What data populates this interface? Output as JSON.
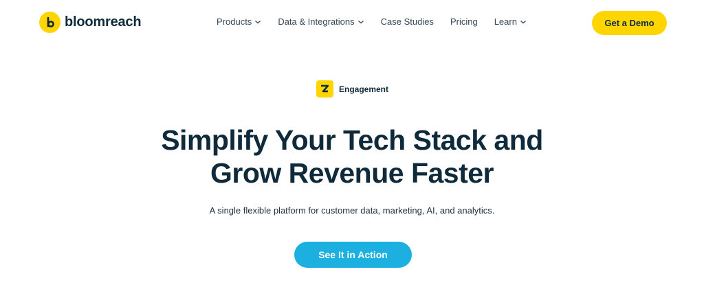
{
  "brand": {
    "name": "bloomreach",
    "mark_icon": "bloomreach-b-logo",
    "accent_color": "#ffd500",
    "text_color": "#0f2a3a"
  },
  "nav": {
    "items": [
      {
        "label": "Products",
        "has_dropdown": true
      },
      {
        "label": "Data & Integrations",
        "has_dropdown": true
      },
      {
        "label": "Case Studies",
        "has_dropdown": false
      },
      {
        "label": "Pricing",
        "has_dropdown": false
      },
      {
        "label": "Learn",
        "has_dropdown": true
      }
    ],
    "cta_label": "Get a Demo"
  },
  "hero": {
    "product_tag": "Engagement",
    "product_icon": "engagement-icon",
    "headline_line1": "Simplify Your Tech Stack and",
    "headline_line2": "Grow Revenue Faster",
    "subtitle": "A single flexible platform for customer data, marketing, AI, and analytics.",
    "cta_label": "See It in Action",
    "cta_color": "#1bb0e0"
  }
}
